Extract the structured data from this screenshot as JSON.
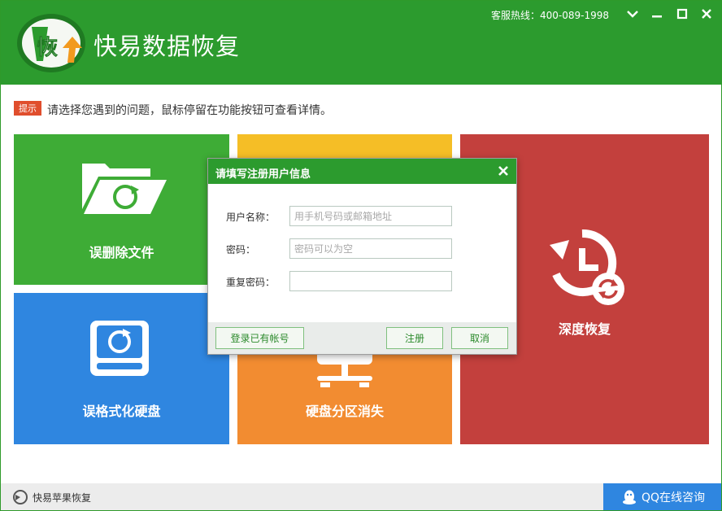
{
  "window": {
    "title": "快易数据恢复",
    "hotline": "客服热线：400-089-1998",
    "logo_char": "恢"
  },
  "tip": {
    "badge": "提示",
    "text": "请选择您遇到的问题，鼠标停留在功能按钮可查看详情。"
  },
  "tiles": {
    "deleted_files": {
      "label": "误删除文件",
      "color": "#3eac36",
      "icon": "folder-refresh-icon"
    },
    "deep_recovery": {
      "label": "深度恢复",
      "color": "#c3403d",
      "icon": "clock-history-icon"
    },
    "formatted_disk": {
      "label": "误格式化硬盘",
      "color": "#2f86e0",
      "icon": "disk-refresh-icon"
    },
    "partition_lost": {
      "label": "硬盘分区消失",
      "color": "#f28c31",
      "icon": "network-drive-icon"
    },
    "yellow_tile": {
      "color": "#f5be26"
    }
  },
  "footer": {
    "apple_recovery": "快易苹果恢复",
    "qq_consult": "QQ在线咨询"
  },
  "dialog": {
    "title": "请填写注册用户信息",
    "username_label": "用户名称：",
    "username_placeholder": "用手机号码或邮箱地址",
    "username_value": "",
    "password_label": "密码：",
    "password_placeholder": "密码可以为空",
    "password_value": "",
    "confirm_label": "重复密码：",
    "confirm_value": "",
    "login_button": "登录已有帐号",
    "register_button": "注册",
    "cancel_button": "取消"
  },
  "colors": {
    "brand_green": "#2c9b2e",
    "accent_blue": "#2f86e0",
    "tip_red": "#e04e2d"
  }
}
